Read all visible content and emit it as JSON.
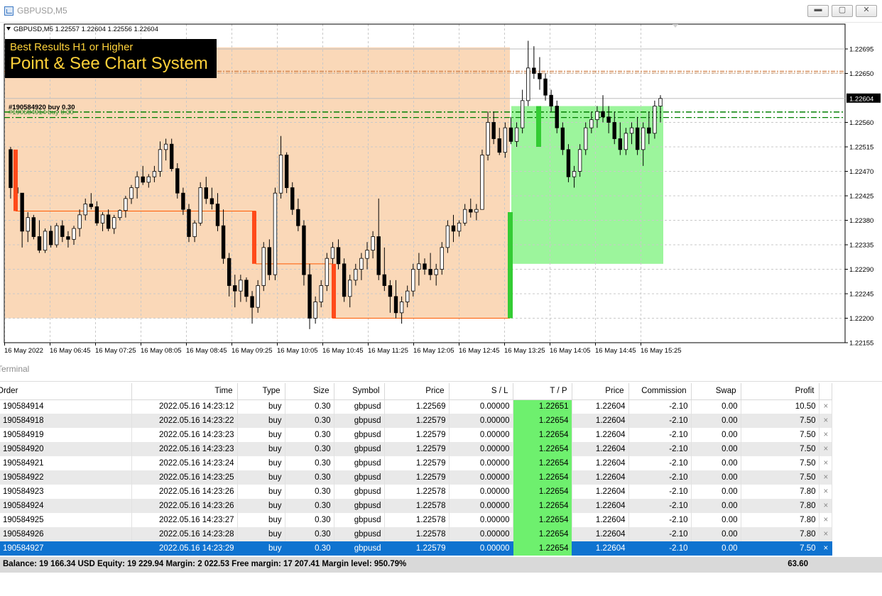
{
  "window": {
    "title": "GBPUSD,M5",
    "min_icon": "minimize-icon",
    "max_icon": "maximize-icon",
    "close_icon": "close-icon"
  },
  "chart": {
    "header": "GBPUSD,M5  1.22557 1.22604 1.22556 1.22604",
    "promo_sub": "Best Results H1 or Higher",
    "promo_main": "Point & See Chart System",
    "current_price": "1.22604",
    "order_label_1": "#190584920 buy 0.30",
    "order_label_2": "#190584914 buy 0.30",
    "price_axis": [
      "1.22695",
      "1.22650",
      "1.22604",
      "1.22560",
      "1.22515",
      "1.22470",
      "1.22425",
      "1.22380",
      "1.22335",
      "1.22290",
      "1.22245",
      "1.22200",
      "1.22155"
    ],
    "time_axis": [
      "16 May 2022",
      "16 May 06:45",
      "16 May 07:25",
      "16 May 08:05",
      "16 May 08:45",
      "16 May 09:25",
      "16 May 10:05",
      "16 May 10:45",
      "16 May 11:25",
      "16 May 12:05",
      "16 May 12:45",
      "16 May 13:25",
      "16 May 14:05",
      "16 May 14:45",
      "16 May 15:25"
    ],
    "colors": {
      "orange_zone": "#fad8b8",
      "green_zone": "#9cf59c",
      "up_candle": "#ffffff",
      "down_candle": "#000000",
      "signal_red": "#ff4a1a",
      "signal_green": "#33cc33",
      "tp_line": "#c86a2a",
      "order_line": "#008000"
    }
  },
  "terminal": {
    "tab_label": "Terminal",
    "columns": [
      "Order",
      "Time",
      "Type",
      "Size",
      "Symbol",
      "Price",
      "S / L",
      "T / P",
      "Price",
      "Commission",
      "Swap",
      "Profit"
    ],
    "rows": [
      [
        "190584914",
        "2022.05.16 14:23:12",
        "buy",
        "0.30",
        "gbpusd",
        "1.22569",
        "0.00000",
        "1.22651",
        "1.22604",
        "-2.10",
        "0.00",
        "10.50"
      ],
      [
        "190584918",
        "2022.05.16 14:23:22",
        "buy",
        "0.30",
        "gbpusd",
        "1.22579",
        "0.00000",
        "1.22654",
        "1.22604",
        "-2.10",
        "0.00",
        "7.50"
      ],
      [
        "190584919",
        "2022.05.16 14:23:23",
        "buy",
        "0.30",
        "gbpusd",
        "1.22579",
        "0.00000",
        "1.22654",
        "1.22604",
        "-2.10",
        "0.00",
        "7.50"
      ],
      [
        "190584920",
        "2022.05.16 14:23:23",
        "buy",
        "0.30",
        "gbpusd",
        "1.22579",
        "0.00000",
        "1.22654",
        "1.22604",
        "-2.10",
        "0.00",
        "7.50"
      ],
      [
        "190584921",
        "2022.05.16 14:23:24",
        "buy",
        "0.30",
        "gbpusd",
        "1.22579",
        "0.00000",
        "1.22654",
        "1.22604",
        "-2.10",
        "0.00",
        "7.50"
      ],
      [
        "190584922",
        "2022.05.16 14:23:25",
        "buy",
        "0.30",
        "gbpusd",
        "1.22579",
        "0.00000",
        "1.22654",
        "1.22604",
        "-2.10",
        "0.00",
        "7.50"
      ],
      [
        "190584923",
        "2022.05.16 14:23:26",
        "buy",
        "0.30",
        "gbpusd",
        "1.22578",
        "0.00000",
        "1.22654",
        "1.22604",
        "-2.10",
        "0.00",
        "7.80"
      ],
      [
        "190584924",
        "2022.05.16 14:23:26",
        "buy",
        "0.30",
        "gbpusd",
        "1.22578",
        "0.00000",
        "1.22654",
        "1.22604",
        "-2.10",
        "0.00",
        "7.80"
      ],
      [
        "190584925",
        "2022.05.16 14:23:27",
        "buy",
        "0.30",
        "gbpusd",
        "1.22578",
        "0.00000",
        "1.22654",
        "1.22604",
        "-2.10",
        "0.00",
        "7.80"
      ],
      [
        "190584926",
        "2022.05.16 14:23:28",
        "buy",
        "0.30",
        "gbpusd",
        "1.22578",
        "0.00000",
        "1.22654",
        "1.22604",
        "-2.10",
        "0.00",
        "7.80"
      ],
      [
        "190584927",
        "2022.05.16 14:23:29",
        "buy",
        "0.30",
        "gbpusd",
        "1.22579",
        "0.00000",
        "1.22654",
        "1.22604",
        "-2.10",
        "0.00",
        "7.50"
      ]
    ],
    "selected_row": 10,
    "close_icon": "close-position-icon",
    "summary": "Balance: 19 166.34 USD  Equity: 19 229.94  Margin: 2 022.53  Free margin: 17 207.41  Margin level: 950.79%",
    "total_profit": "63.60"
  }
}
